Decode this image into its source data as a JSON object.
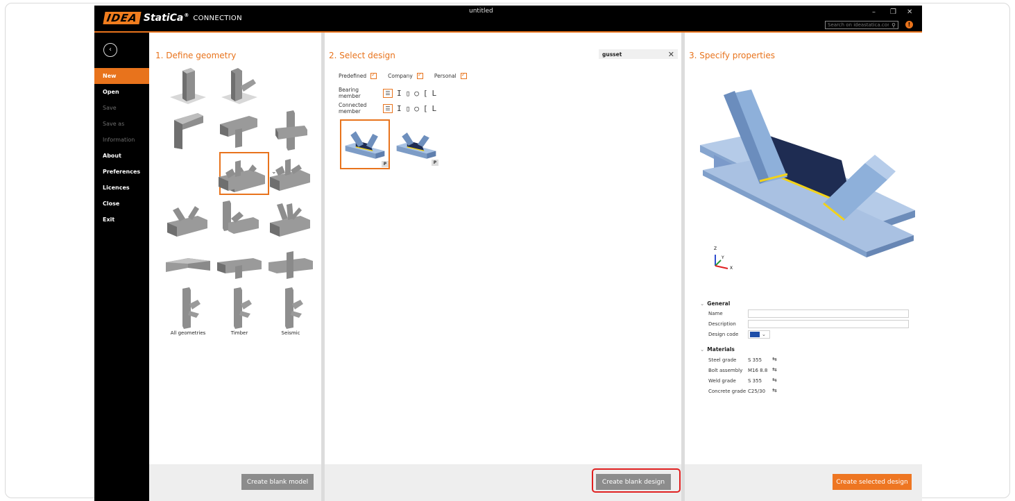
{
  "window": {
    "title": "untitled",
    "logo_mark": "IDEA",
    "logo_brand": "StatiCa",
    "logo_reg": "®",
    "logo_product": "CONNECTION",
    "search_placeholder": "Search on ideastatica.com",
    "minimize": "–",
    "maximize": "❐",
    "close": "✕",
    "info": "!"
  },
  "sidebar": {
    "back": "‹",
    "items": [
      {
        "label": "New",
        "state": "active"
      },
      {
        "label": "Open",
        "state": "enabled"
      },
      {
        "label": "Save",
        "state": "disabled"
      },
      {
        "label": "Save as",
        "state": "disabled"
      },
      {
        "label": "Information",
        "state": "disabled"
      },
      {
        "label": "About",
        "state": "enabled"
      },
      {
        "label": "Preferences",
        "state": "enabled"
      },
      {
        "label": "Licences",
        "state": "enabled"
      },
      {
        "label": "Close",
        "state": "enabled"
      },
      {
        "label": "Exit",
        "state": "enabled"
      }
    ]
  },
  "geometry": {
    "title": "1. Define geometry",
    "labels": {
      "all": "All geometries",
      "timber": "Timber",
      "seismic": "Seismic"
    },
    "dropdown_chevron": "⌄",
    "footer_button": "Create blank model"
  },
  "design": {
    "title": "2. Select design",
    "search_value": "gusset",
    "search_clear": "✕",
    "filters": {
      "predefined": "Predefined",
      "company": "Company",
      "personal": "Personal"
    },
    "bearing_member": "Bearing member",
    "connected_member": "Connected member",
    "shape_glyphs": [
      "I",
      "▯",
      "○",
      "[",
      "L"
    ],
    "badge": "P",
    "footer_button": "Create blank design"
  },
  "properties": {
    "title": "3. Specify properties",
    "axes": {
      "z": "Z",
      "y": "Y",
      "x": "X"
    },
    "general": {
      "heading": "General",
      "name_label": "Name",
      "name_value": "",
      "description_label": "Description",
      "description_value": "",
      "design_code_label": "Design code",
      "design_code_chevron": "⌄"
    },
    "materials": {
      "heading": "Materials",
      "rows": [
        {
          "label": "Steel grade",
          "value": "S 355"
        },
        {
          "label": "Bolt assembly",
          "value": "M16 8.8"
        },
        {
          "label": "Weld grade",
          "value": "S 355"
        },
        {
          "label": "Concrete grade",
          "value": "C25/30"
        }
      ]
    },
    "footer_button": "Create selected design"
  },
  "colors": {
    "accent": "#e8731c",
    "steel_gray": "#9a9a9a",
    "model_blue": "#8fb0d8",
    "gusset_navy": "#1e2c52",
    "weld_yellow": "#f2d21a",
    "highlight_red": "#e02020"
  }
}
